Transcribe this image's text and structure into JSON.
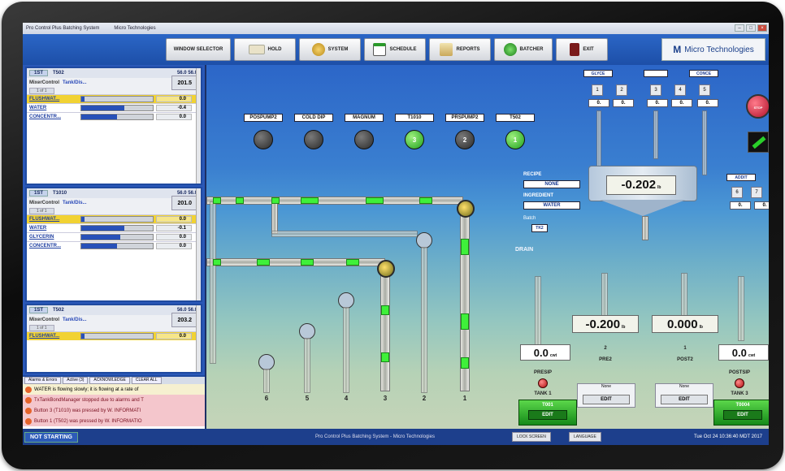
{
  "app": {
    "title": "Pro Control Plus Batching System",
    "subtitle": "Micro Technologies"
  },
  "toolbar": {
    "window_selector": "WINDOW SELECTOR",
    "hold": "HOLD",
    "system": "SYSTEM",
    "schedule": "SCHEDULE",
    "reports": "REPORTS",
    "batcher": "BATCHER",
    "exit": "EXIT",
    "brand": "Micro Technologies"
  },
  "cards": [
    {
      "code": "1ST",
      "tank": "T502",
      "nums": "56.0  56.0",
      "mixer": "MixerControl",
      "tank_link": "Tank/Dis...",
      "value": "201.5",
      "lot": "1 of 1",
      "ingredients": [
        {
          "name": "FLUSHWAT...",
          "value": "0.0",
          "fill": 0.05,
          "hl": true
        },
        {
          "name": "WATER",
          "value": "-0.4",
          "fill": 0.6,
          "hl": false
        },
        {
          "name": "CONCENTR...",
          "value": "0.0",
          "fill": 0.5,
          "hl": false
        }
      ]
    },
    {
      "code": "1ST",
      "tank": "T1010",
      "nums": "56.0  56.0",
      "mixer": "MixerControl",
      "tank_link": "Tank/Dis...",
      "value": "201.0",
      "lot": "1 of 1",
      "ingredients": [
        {
          "name": "FLUSHWAT...",
          "value": "0.0",
          "fill": 0.05,
          "hl": true
        },
        {
          "name": "WATER",
          "value": "-0.1",
          "fill": 0.6,
          "hl": false
        },
        {
          "name": "GLYCERIN",
          "value": "0.0",
          "fill": 0.55,
          "hl": false
        },
        {
          "name": "CONCENTR...",
          "value": "0.0",
          "fill": 0.5,
          "hl": false
        }
      ]
    },
    {
      "code": "1ST",
      "tank": "T502",
      "nums": "56.0  56.0",
      "mixer": "MixerControl",
      "tank_link": "Tank/Dis...",
      "value": "203.2",
      "lot": "1 of 1",
      "ingredients": [
        {
          "name": "FLUSHWAT...",
          "value": "0.0",
          "fill": 0.05,
          "hl": true
        }
      ]
    }
  ],
  "alarm_tabs": [
    "Alarms & Errors",
    "Active (3)",
    "ACKNOWLEDGE",
    "CLEAR ALL"
  ],
  "alarms": [
    {
      "text": "WATER is flowing slowly; it is flowing at a rate of",
      "type": "warn"
    },
    {
      "text": "TxTankBondManager stopped due to alarms and T",
      "type": "err"
    },
    {
      "text": "Button 3 (T1010) was pressed by W.    INFORMATI",
      "type": "err"
    },
    {
      "text": "Button 1 (T502) was pressed by W.     INFORMATIO",
      "type": "err"
    }
  ],
  "status": {
    "state": "NOT STARTING",
    "center": "Pro Control Plus Batching System  -  Micro Technologies",
    "lock": "LOCK SCREEN",
    "language": "LANGUAGE",
    "datetime": "Tue Oct 24 10:36:40 MDT 2017"
  },
  "pumps": [
    {
      "label": "POSPUMP2",
      "num": "",
      "on": false
    },
    {
      "label": "COLD DIP",
      "num": "",
      "on": false
    },
    {
      "label": "MAGNUM",
      "num": "",
      "on": false
    },
    {
      "label": "T1010",
      "num": "3",
      "on": true
    },
    {
      "label": "PRSPUMP2",
      "num": "2",
      "on": false
    },
    {
      "label": "T502",
      "num": "1",
      "on": true
    }
  ],
  "outlets": [
    "6",
    "5",
    "4",
    "3",
    "2",
    "1"
  ],
  "drain": "DRAIN",
  "recipe_info": {
    "recipe_label": "RECIPE",
    "recipe": "NONE",
    "ingredient_label": "INGREDIENT",
    "ingredient": "WATER",
    "batch_label": "Batch",
    "batch": "TK2"
  },
  "main_scale": {
    "value": "-0.202",
    "unit": "lb"
  },
  "top_groups": {
    "glyce": "GLYCE",
    "conce": "CONCE",
    "addit": "ADDIT"
  },
  "tanks": [
    {
      "name": "PRESIP",
      "sub": "TANK 1",
      "reading": "0.0",
      "unit": "cwt",
      "recipe": "None",
      "edit": "EDIT",
      "btn_top": "T001",
      "btn": "EDIT"
    },
    {
      "name": "PRE2",
      "sub": "2",
      "reading": "-0.200",
      "unit": "lb",
      "recipe": "None",
      "edit": "EDIT"
    },
    {
      "name": "POST2",
      "sub": "1",
      "reading": "0.000",
      "unit": "lb",
      "recipe": "None",
      "edit": "EDIT"
    },
    {
      "name": "POSTSIP",
      "sub": "TANK 3",
      "reading": "0.0",
      "unit": "cwt",
      "btn_top": "T0004",
      "btn": "EDIT"
    }
  ],
  "colors": {
    "accent": "#1d4fa8",
    "flow": "#3ff03a",
    "alarm_highlight": "#f1d233"
  },
  "icons": [
    "hold-icon",
    "system-icon",
    "schedule-icon",
    "reports-icon",
    "batcher-icon",
    "exit-icon",
    "logo-icon",
    "estop-icon",
    "key-switch-icon",
    "pump-icon",
    "valve-icon",
    "alarm-dot-icon"
  ]
}
